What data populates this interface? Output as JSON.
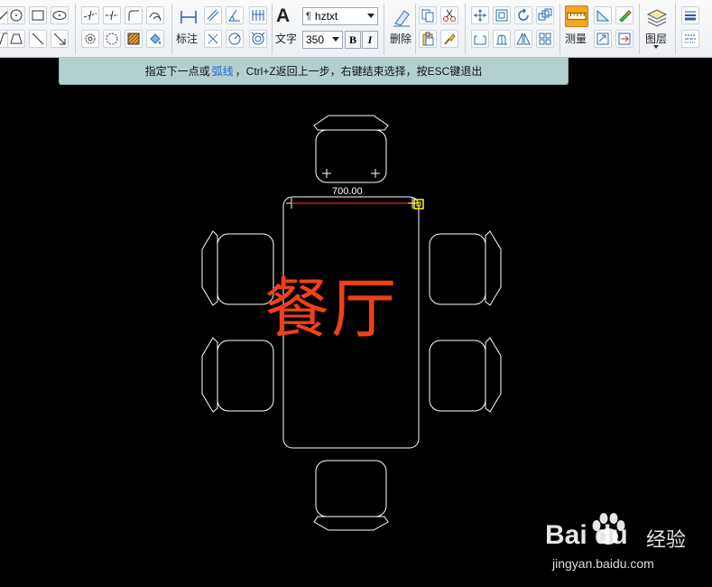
{
  "toolbar": {
    "dimension_label": "标注",
    "text_label": "文字",
    "font_select": "hztxt",
    "size_select": "350",
    "bold_label": "B",
    "italic_label": "I",
    "delete_label": "删除",
    "measure_label": "测量",
    "layer_label": "图层"
  },
  "hint": {
    "before": "指定下一点或",
    "keyword": "弧线",
    "after": "，Ctrl+Z返回上一步，右键结束选择，按ESC键退出"
  },
  "drawing": {
    "dimension_value": "700.00",
    "room_label": "餐厅"
  },
  "watermark": {
    "brand": "Bai du",
    "name": "经验",
    "url": "jingyan.baidu.com"
  },
  "colors": {
    "toolbar_bg": "#eceff3",
    "hint_bg": "#b3d0cf",
    "hint_keyword": "#1769d0",
    "label_color": "#f0401a",
    "measure_line": "#e02020",
    "snap_box": "#ffff00",
    "accent_orange": "#f5a623"
  }
}
